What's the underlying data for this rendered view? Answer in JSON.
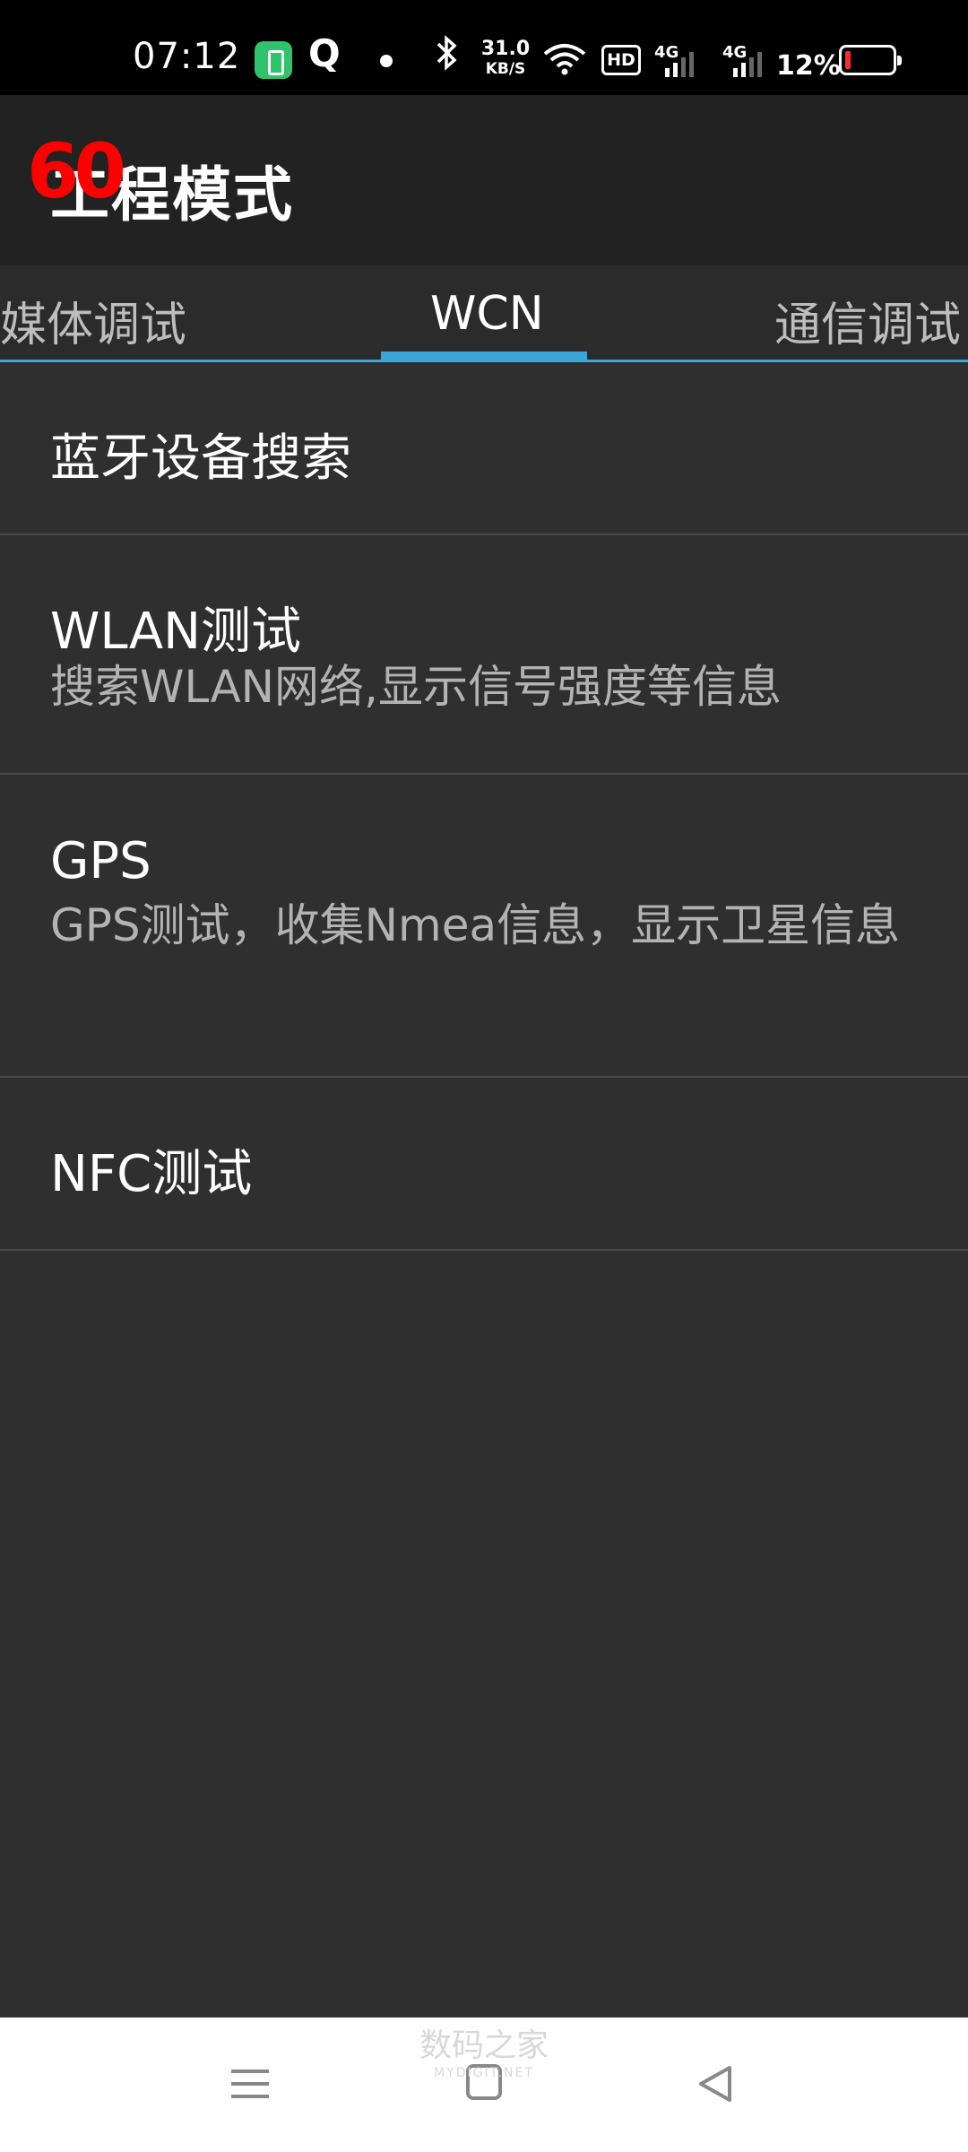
{
  "status_bar": {
    "time": "07:12",
    "speed_value": "31.0",
    "speed_unit": "KB/S",
    "hd_label": "HD",
    "signal_1_label": "4G",
    "signal_2_label": "4G",
    "battery_percent": "12%",
    "battery_level": 0.12,
    "icons": [
      "battery-app-icon",
      "q-app-icon",
      "notification-dot-icon",
      "bluetooth-icon",
      "wifi-icon",
      "hd-icon",
      "signal-icon",
      "signal-icon",
      "battery-icon"
    ]
  },
  "action_bar": {
    "title": "工程模式",
    "overlay_mark": "60"
  },
  "tabs": {
    "items": [
      {
        "label": "媒体调试",
        "selected": false
      },
      {
        "label": "WCN",
        "selected": true
      },
      {
        "label": "通信调试",
        "selected": false
      }
    ],
    "indicator_color": "#3aa7d8"
  },
  "list": {
    "items": [
      {
        "title": "蓝牙设备搜索"
      },
      {
        "title": "WLAN测试",
        "subtitle": "搜索WLAN网络,显示信号强度等信息"
      },
      {
        "title": "GPS",
        "subtitle": "GPS测试，收集Nmea信息，显示卫星信息"
      },
      {
        "title": "NFC测试"
      }
    ]
  },
  "nav_bar": {
    "buttons": [
      "menu-icon",
      "home-icon",
      "back-icon"
    ],
    "watermark_main": "数码之家",
    "watermark_sub": "MYDIGIT.NET"
  },
  "colors": {
    "background": "#2f2f2f",
    "action_bar": "#222222",
    "accent": "#3aa7d8",
    "battery_low": "#ff2b2b"
  }
}
